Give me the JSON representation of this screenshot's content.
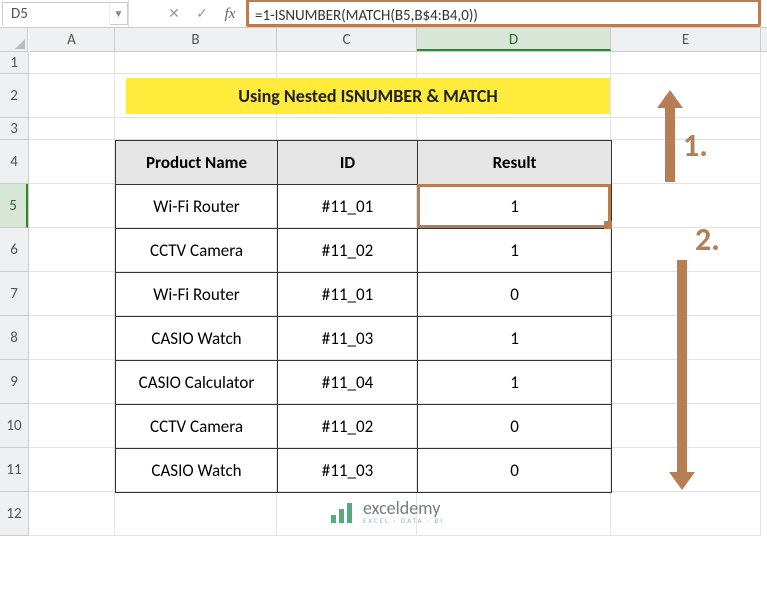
{
  "namebox": {
    "value": "D5"
  },
  "fx": {
    "cancel": "✕",
    "confirm": "✓",
    "label": "fx"
  },
  "formula": "=1-ISNUMBER(MATCH(B5,B$4:B4,0))",
  "columns": [
    "A",
    "B",
    "C",
    "D",
    "E"
  ],
  "rows": [
    "1",
    "2",
    "3",
    "4",
    "5",
    "6",
    "7",
    "8",
    "9",
    "10",
    "11",
    "12"
  ],
  "title": "Using Nested ISNUMBER & MATCH",
  "table": {
    "headers": {
      "product": "Product Name",
      "id": "ID",
      "result": "Result"
    },
    "rows": [
      {
        "product": "Wi-Fi Router",
        "id": "#11_01",
        "result": "1"
      },
      {
        "product": "CCTV Camera",
        "id": "#11_02",
        "result": "1"
      },
      {
        "product": "Wi-Fi Router",
        "id": "#11_01",
        "result": "0"
      },
      {
        "product": "CASIO Watch",
        "id": "#11_03",
        "result": "1"
      },
      {
        "product": "CASIO Calculator",
        "id": "#11_04",
        "result": "1"
      },
      {
        "product": "CCTV Camera",
        "id": "#11_02",
        "result": "0"
      },
      {
        "product": "CASIO Watch",
        "id": "#11_03",
        "result": "0"
      }
    ]
  },
  "callouts": {
    "one": "1.",
    "two": "2."
  },
  "brand": {
    "name": "exceldemy",
    "tag": "EXCEL · DATA · BI"
  },
  "selected_row": "5",
  "selected_col": "D"
}
